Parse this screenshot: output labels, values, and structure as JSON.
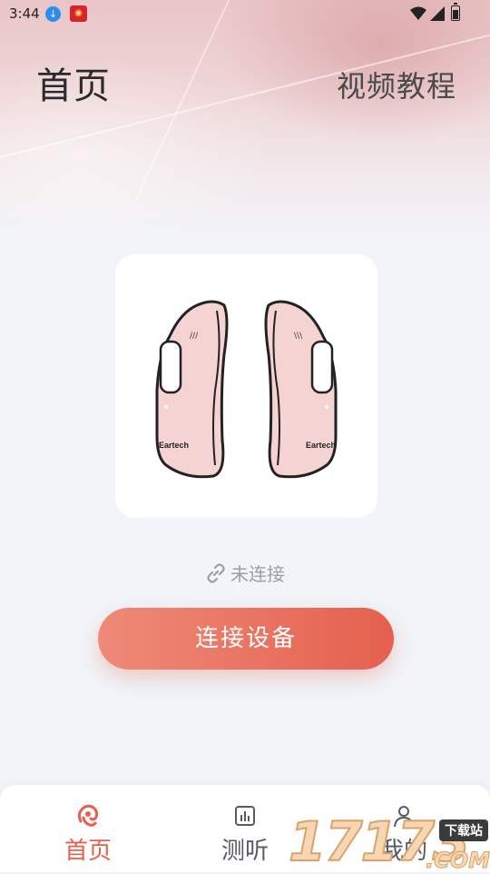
{
  "status_bar": {
    "time": "3:44"
  },
  "header": {
    "title": "首页",
    "tutorial_link": "视频教程"
  },
  "device": {
    "brand_left": "Eartech",
    "brand_right": "Eartech"
  },
  "connection": {
    "status_text": "未连接",
    "connect_button": "连接设备"
  },
  "bottom_nav": {
    "items": [
      {
        "label": "首页",
        "icon": "hearing-aid-icon",
        "active": true
      },
      {
        "label": "测听",
        "icon": "chart-icon",
        "active": false
      },
      {
        "label": "我的",
        "icon": "person-icon",
        "active": false
      }
    ]
  },
  "watermark": {
    "number": "17173",
    "tag": "下载站",
    "suffix": ".COM"
  },
  "colors": {
    "accent": "#e5604e",
    "device_pink": "#f5d3d3"
  }
}
